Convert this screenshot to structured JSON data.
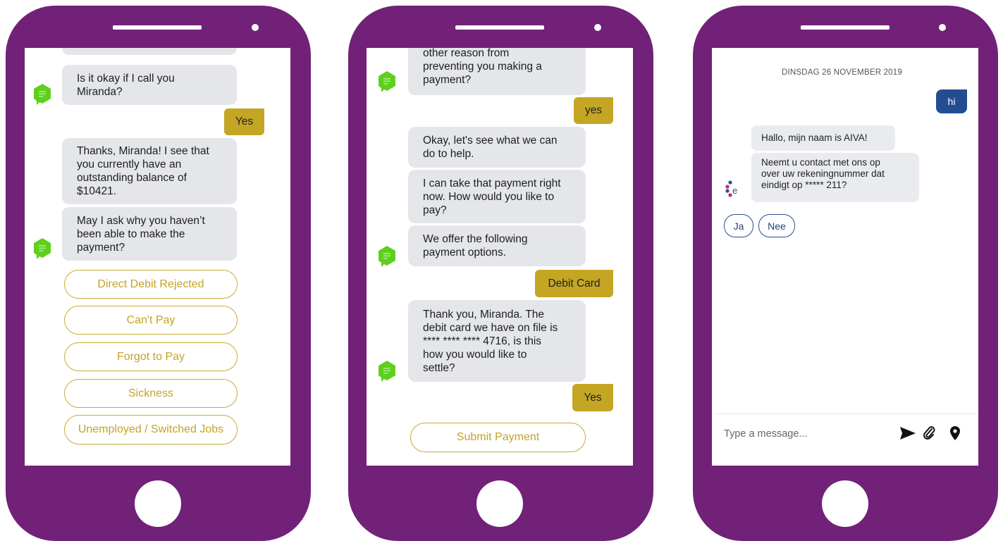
{
  "phone1": {
    "msg_partial": "",
    "msg_call": "Is it okay if I call you\nMiranda?",
    "user_yes": "Yes",
    "msg_thanks": "Thanks, Miranda! I see that\nyou currently have an\noutstanding balance of\n$10421.",
    "msg_ask": "May I ask why you haven’t\nbeen able to make the\npayment?",
    "options": [
      "Direct Debit Rejected",
      "Can't Pay",
      "Forgot to Pay",
      "Sickness",
      "Unemployed / Switched Jobs"
    ]
  },
  "phone2": {
    "msg_reason": "other reason from\npreventing you making a\npayment?",
    "user_yes1": "yes",
    "msg_okay": "Okay, let's see what we can\ndo to help.",
    "msg_take": "I can take that payment right\nnow. How would you like to\npay?",
    "msg_offer": "We offer the following\npayment options.",
    "user_debit": "Debit Card",
    "msg_thankyou": "Thank you, Miranda. The\ndebit card we have on file is\n**** **** **** 4716, is this\nhow you would like to\nsettle?",
    "user_yes2": "Yes",
    "submit_label": "Submit Payment"
  },
  "phone3": {
    "date": "DINSDAG 26 NOVEMBER 2019",
    "user_hi": "hi",
    "msg_hallo": "Hallo, mijn naam is AIVA!",
    "msg_contact": "Neemt u contact met ons op\nover uw rekeningnummer dat\neindigt op ***** 211?",
    "chips": [
      "Ja",
      "Nee"
    ],
    "input_placeholder": "Type a message...",
    "icons": [
      "send-icon",
      "paperclip-icon",
      "location-pin-icon"
    ]
  },
  "colors": {
    "phone": "#712178",
    "bot_icon": "#5fcf1e",
    "gold": "#c4a624",
    "navy": "#244d91"
  }
}
